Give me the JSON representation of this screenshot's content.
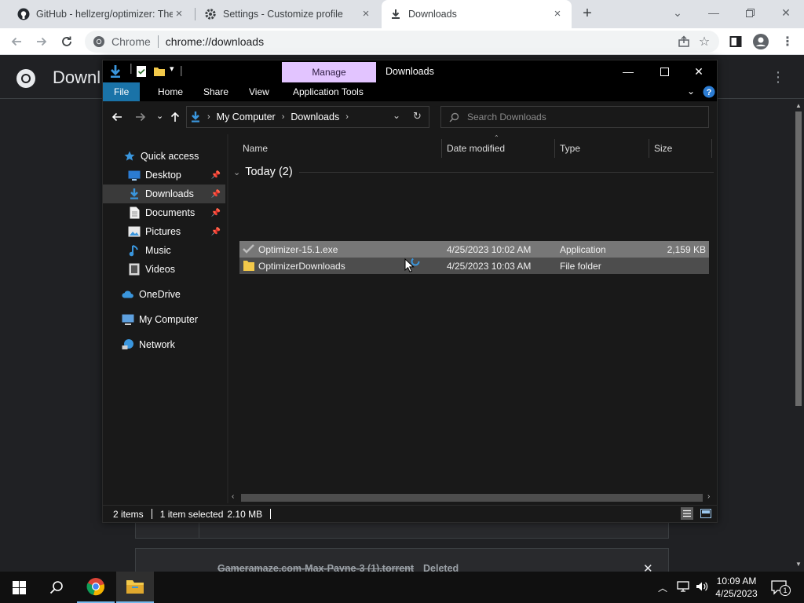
{
  "chrome": {
    "tabs": [
      {
        "title": "GitHub - hellzerg/optimizer: The",
        "active": false
      },
      {
        "title": "Settings - Customize profile",
        "active": false
      },
      {
        "title": "Downloads",
        "active": true
      }
    ],
    "omnibox": {
      "scheme_label": "Chrome",
      "url": "chrome://downloads"
    },
    "page": {
      "title": "Downl",
      "download_entry": {
        "filename": "Gameramaze.com-Max-Payne-3 (1).torrent",
        "status": "Deleted"
      }
    }
  },
  "explorer": {
    "title": "Downloads",
    "manage_tab": "Manage",
    "ribbon_tabs": [
      "File",
      "Home",
      "Share",
      "View",
      "Application Tools"
    ],
    "breadcrumb": [
      "My Computer",
      "Downloads"
    ],
    "search_placeholder": "Search Downloads",
    "nav": [
      {
        "label": "Quick access",
        "icon": "star-icon"
      },
      {
        "label": "Desktop",
        "icon": "desktop-icon",
        "pinned": true
      },
      {
        "label": "Downloads",
        "icon": "download-icon",
        "pinned": true,
        "selected": true
      },
      {
        "label": "Documents",
        "icon": "document-icon",
        "pinned": true
      },
      {
        "label": "Pictures",
        "icon": "picture-icon",
        "pinned": true
      },
      {
        "label": "Music",
        "icon": "music-icon"
      },
      {
        "label": "Videos",
        "icon": "video-icon"
      },
      {
        "label": "OneDrive",
        "icon": "cloud-icon"
      },
      {
        "label": "My Computer",
        "icon": "computer-icon"
      },
      {
        "label": "Network",
        "icon": "network-icon"
      }
    ],
    "columns": [
      "Name",
      "Date modified",
      "Type",
      "Size"
    ],
    "group": "Today (2)",
    "files": [
      {
        "name": "Optimizer-15.1.exe",
        "date": "4/25/2023 10:02 AM",
        "type": "Application",
        "size": "2,159 KB",
        "icon": "application-icon",
        "state": "selected"
      },
      {
        "name": "OptimizerDownloads",
        "date": "4/25/2023 10:03 AM",
        "type": "File folder",
        "size": "",
        "icon": "folder-icon",
        "state": "hover"
      }
    ],
    "status": {
      "items": "2 items",
      "selected": "1 item selected",
      "size": "2.10 MB"
    }
  },
  "taskbar": {
    "time": "10:09 AM",
    "date": "4/25/2023",
    "notifications": "1"
  },
  "colors": {
    "accent": "#1a73a8",
    "manage": "#e2c4ff",
    "selected_row": "#777777"
  }
}
